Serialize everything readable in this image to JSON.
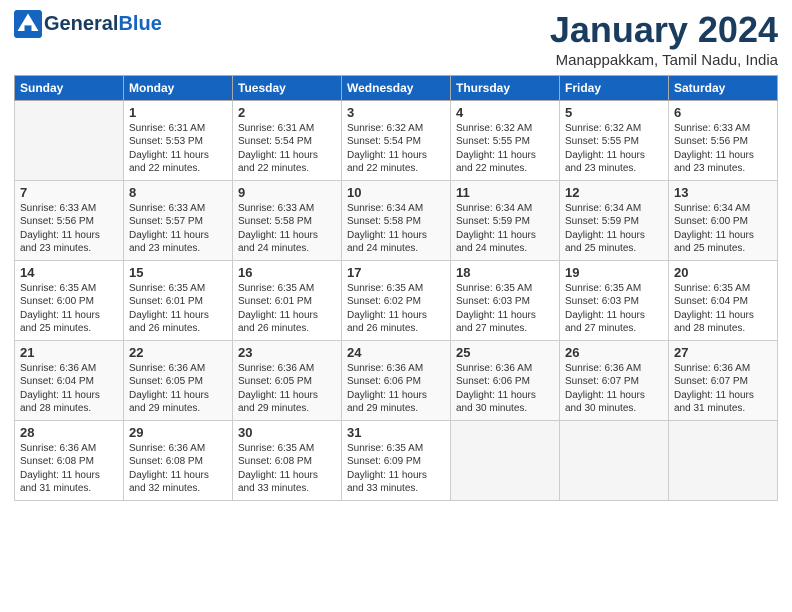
{
  "header": {
    "logo_general": "General",
    "logo_blue": "Blue",
    "title": "January 2024",
    "subtitle": "Manappakkam, Tamil Nadu, India"
  },
  "columns": [
    "Sunday",
    "Monday",
    "Tuesday",
    "Wednesday",
    "Thursday",
    "Friday",
    "Saturday"
  ],
  "weeks": [
    [
      {
        "day": "",
        "info": ""
      },
      {
        "day": "1",
        "info": "Sunrise: 6:31 AM\nSunset: 5:53 PM\nDaylight: 11 hours\nand 22 minutes."
      },
      {
        "day": "2",
        "info": "Sunrise: 6:31 AM\nSunset: 5:54 PM\nDaylight: 11 hours\nand 22 minutes."
      },
      {
        "day": "3",
        "info": "Sunrise: 6:32 AM\nSunset: 5:54 PM\nDaylight: 11 hours\nand 22 minutes."
      },
      {
        "day": "4",
        "info": "Sunrise: 6:32 AM\nSunset: 5:55 PM\nDaylight: 11 hours\nand 22 minutes."
      },
      {
        "day": "5",
        "info": "Sunrise: 6:32 AM\nSunset: 5:55 PM\nDaylight: 11 hours\nand 23 minutes."
      },
      {
        "day": "6",
        "info": "Sunrise: 6:33 AM\nSunset: 5:56 PM\nDaylight: 11 hours\nand 23 minutes."
      }
    ],
    [
      {
        "day": "7",
        "info": "Sunrise: 6:33 AM\nSunset: 5:56 PM\nDaylight: 11 hours\nand 23 minutes."
      },
      {
        "day": "8",
        "info": "Sunrise: 6:33 AM\nSunset: 5:57 PM\nDaylight: 11 hours\nand 23 minutes."
      },
      {
        "day": "9",
        "info": "Sunrise: 6:33 AM\nSunset: 5:58 PM\nDaylight: 11 hours\nand 24 minutes."
      },
      {
        "day": "10",
        "info": "Sunrise: 6:34 AM\nSunset: 5:58 PM\nDaylight: 11 hours\nand 24 minutes."
      },
      {
        "day": "11",
        "info": "Sunrise: 6:34 AM\nSunset: 5:59 PM\nDaylight: 11 hours\nand 24 minutes."
      },
      {
        "day": "12",
        "info": "Sunrise: 6:34 AM\nSunset: 5:59 PM\nDaylight: 11 hours\nand 25 minutes."
      },
      {
        "day": "13",
        "info": "Sunrise: 6:34 AM\nSunset: 6:00 PM\nDaylight: 11 hours\nand 25 minutes."
      }
    ],
    [
      {
        "day": "14",
        "info": "Sunrise: 6:35 AM\nSunset: 6:00 PM\nDaylight: 11 hours\nand 25 minutes."
      },
      {
        "day": "15",
        "info": "Sunrise: 6:35 AM\nSunset: 6:01 PM\nDaylight: 11 hours\nand 26 minutes."
      },
      {
        "day": "16",
        "info": "Sunrise: 6:35 AM\nSunset: 6:01 PM\nDaylight: 11 hours\nand 26 minutes."
      },
      {
        "day": "17",
        "info": "Sunrise: 6:35 AM\nSunset: 6:02 PM\nDaylight: 11 hours\nand 26 minutes."
      },
      {
        "day": "18",
        "info": "Sunrise: 6:35 AM\nSunset: 6:03 PM\nDaylight: 11 hours\nand 27 minutes."
      },
      {
        "day": "19",
        "info": "Sunrise: 6:35 AM\nSunset: 6:03 PM\nDaylight: 11 hours\nand 27 minutes."
      },
      {
        "day": "20",
        "info": "Sunrise: 6:35 AM\nSunset: 6:04 PM\nDaylight: 11 hours\nand 28 minutes."
      }
    ],
    [
      {
        "day": "21",
        "info": "Sunrise: 6:36 AM\nSunset: 6:04 PM\nDaylight: 11 hours\nand 28 minutes."
      },
      {
        "day": "22",
        "info": "Sunrise: 6:36 AM\nSunset: 6:05 PM\nDaylight: 11 hours\nand 29 minutes."
      },
      {
        "day": "23",
        "info": "Sunrise: 6:36 AM\nSunset: 6:05 PM\nDaylight: 11 hours\nand 29 minutes."
      },
      {
        "day": "24",
        "info": "Sunrise: 6:36 AM\nSunset: 6:06 PM\nDaylight: 11 hours\nand 29 minutes."
      },
      {
        "day": "25",
        "info": "Sunrise: 6:36 AM\nSunset: 6:06 PM\nDaylight: 11 hours\nand 30 minutes."
      },
      {
        "day": "26",
        "info": "Sunrise: 6:36 AM\nSunset: 6:07 PM\nDaylight: 11 hours\nand 30 minutes."
      },
      {
        "day": "27",
        "info": "Sunrise: 6:36 AM\nSunset: 6:07 PM\nDaylight: 11 hours\nand 31 minutes."
      }
    ],
    [
      {
        "day": "28",
        "info": "Sunrise: 6:36 AM\nSunset: 6:08 PM\nDaylight: 11 hours\nand 31 minutes."
      },
      {
        "day": "29",
        "info": "Sunrise: 6:36 AM\nSunset: 6:08 PM\nDaylight: 11 hours\nand 32 minutes."
      },
      {
        "day": "30",
        "info": "Sunrise: 6:35 AM\nSunset: 6:08 PM\nDaylight: 11 hours\nand 33 minutes."
      },
      {
        "day": "31",
        "info": "Sunrise: 6:35 AM\nSunset: 6:09 PM\nDaylight: 11 hours\nand 33 minutes."
      },
      {
        "day": "",
        "info": ""
      },
      {
        "day": "",
        "info": ""
      },
      {
        "day": "",
        "info": ""
      }
    ]
  ]
}
